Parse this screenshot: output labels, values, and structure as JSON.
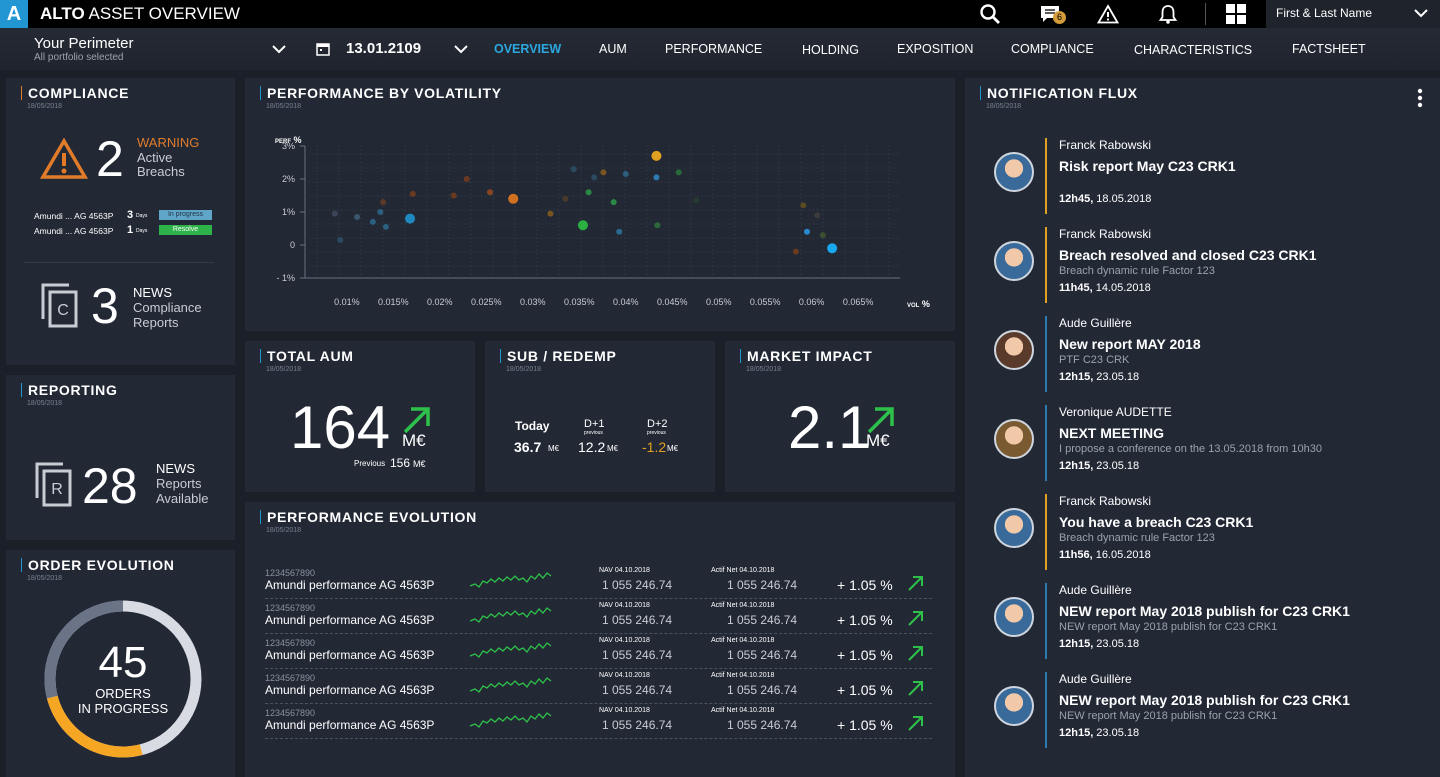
{
  "header": {
    "logo": "A",
    "title_bold": "ALTO",
    "title_rest": " ASSET OVERVIEW",
    "badge_count": "6",
    "user_name": "First & Last Name"
  },
  "perimeter": {
    "title": "Your Perimeter",
    "subtitle": "All portfolio selected",
    "date": "13.01.2109"
  },
  "nav": {
    "tabs": [
      "OVERVIEW",
      "AUM",
      "PERFORMANCE",
      "HOLDING",
      "EXPOSITION",
      "COMPLIANCE",
      "CHARACTERISTICS",
      "FACTSHEET"
    ],
    "active": "OVERVIEW"
  },
  "compliance": {
    "title": "COMPLIANCE",
    "date": "18/05/2018",
    "count": "2",
    "warning": "WARNING",
    "line1": "Active",
    "line2": "Breachs",
    "rows": [
      {
        "name": "Amundi ... AG 4563P",
        "days": "3",
        "days_label": "Days",
        "status": "In progress",
        "color": "#5fa6c8"
      },
      {
        "name": "Amundi ... AG 4563P",
        "days": "1",
        "days_label": "Days",
        "status": "Resolve",
        "color": "#2eb24a"
      }
    ],
    "news_count": "3",
    "news": "NEWS",
    "news_l1": "Compliance",
    "news_l2": "Reports",
    "icon_letter": "C"
  },
  "reporting": {
    "title": "REPORTING",
    "date": "18/05/2018",
    "count": "28",
    "news": "NEWS",
    "l1": "Reports",
    "l2": "Available",
    "icon_letter": "R"
  },
  "orders": {
    "title": "ORDER EVOLUTION",
    "date": "18/05/2018",
    "count": "45",
    "l1": "ORDERS",
    "l2": "IN PROGRESS",
    "progress": 0.25
  },
  "perf_vol": {
    "title": "PERFORMANCE BY VOLATILITY",
    "date": "18/05/2018"
  },
  "chart_data": {
    "type": "scatter",
    "title": "PERFORMANCE BY VOLATILITY",
    "xlabel": "VOL %",
    "ylabel": "PERF %",
    "x_ticks": [
      "0.01%",
      "0.015%",
      "0.02%",
      "0.025%",
      "0.03%",
      "0.035%",
      "0.04%",
      "0.045%",
      "0.05%",
      "0.055%",
      "0.06%",
      "0.065%"
    ],
    "y_ticks": [
      "3%",
      "2%",
      "1%",
      "0",
      "- 1%"
    ],
    "xlim": [
      0.0055,
      0.0695
    ],
    "ylim": [
      -1,
      3
    ],
    "points": [
      {
        "x": 0.0087,
        "y": 0.95,
        "color": "#3a4558",
        "r": 3
      },
      {
        "x": 0.0093,
        "y": 0.15,
        "color": "#2a4a60",
        "r": 3
      },
      {
        "x": 0.0111,
        "y": 0.85,
        "color": "#3d5670",
        "r": 3
      },
      {
        "x": 0.0128,
        "y": 0.7,
        "color": "#2c5f80",
        "r": 3
      },
      {
        "x": 0.0136,
        "y": 1.0,
        "color": "#2c5f80",
        "r": 3
      },
      {
        "x": 0.0139,
        "y": 1.3,
        "color": "#5a3a2a",
        "r": 3
      },
      {
        "x": 0.0142,
        "y": 0.55,
        "color": "#2c5f80",
        "r": 3
      },
      {
        "x": 0.0168,
        "y": 0.8,
        "color": "#1f8ac0",
        "r": 5
      },
      {
        "x": 0.0171,
        "y": 1.55,
        "color": "#6a3a20",
        "r": 3
      },
      {
        "x": 0.0215,
        "y": 1.5,
        "color": "#6a3a20",
        "r": 3
      },
      {
        "x": 0.0229,
        "y": 2.0,
        "color": "#6a3a20",
        "r": 3
      },
      {
        "x": 0.0254,
        "y": 1.6,
        "color": "#8a4520",
        "r": 3
      },
      {
        "x": 0.0279,
        "y": 1.4,
        "color": "#d07020",
        "r": 5
      },
      {
        "x": 0.0319,
        "y": 0.95,
        "color": "#7a5520",
        "r": 3
      },
      {
        "x": 0.0335,
        "y": 1.4,
        "color": "#4a3a2a",
        "r": 3
      },
      {
        "x": 0.0344,
        "y": 2.3,
        "color": "#2a4a60",
        "r": 3
      },
      {
        "x": 0.0354,
        "y": 0.6,
        "color": "#2ab040",
        "r": 5
      },
      {
        "x": 0.036,
        "y": 1.6,
        "color": "#2a8a45",
        "r": 3
      },
      {
        "x": 0.0366,
        "y": 2.05,
        "color": "#2a4a60",
        "r": 3
      },
      {
        "x": 0.0376,
        "y": 2.2,
        "color": "#7a5520",
        "r": 3
      },
      {
        "x": 0.0387,
        "y": 1.3,
        "color": "#2a8a45",
        "r": 3
      },
      {
        "x": 0.0393,
        "y": 0.4,
        "color": "#2a6a90",
        "r": 3
      },
      {
        "x": 0.04,
        "y": 2.15,
        "color": "#2c5f80",
        "r": 3
      },
      {
        "x": 0.0433,
        "y": 2.7,
        "color": "#e0a020",
        "r": 5
      },
      {
        "x": 0.0433,
        "y": 2.05,
        "color": "#2c7ab0",
        "r": 3
      },
      {
        "x": 0.0434,
        "y": 0.6,
        "color": "#2a6a3a",
        "r": 3
      },
      {
        "x": 0.0457,
        "y": 2.2,
        "color": "#2a6a3a",
        "r": 3
      },
      {
        "x": 0.0476,
        "y": 1.35,
        "color": "#263a30",
        "r": 3
      },
      {
        "x": 0.0583,
        "y": -0.2,
        "color": "#6a3a20",
        "r": 3
      },
      {
        "x": 0.0591,
        "y": 1.2,
        "color": "#5a4a20",
        "r": 3
      },
      {
        "x": 0.0595,
        "y": 0.4,
        "color": "#2a8ad0",
        "r": 3
      },
      {
        "x": 0.0606,
        "y": 0.9,
        "color": "#3a3a3a",
        "r": 3
      },
      {
        "x": 0.0612,
        "y": 0.3,
        "color": "#3a5030",
        "r": 3
      },
      {
        "x": 0.0622,
        "y": -0.1,
        "color": "#18a8f0",
        "r": 5
      }
    ]
  },
  "total_aum": {
    "title": "TOTAL  AUM",
    "date": "18/05/2018",
    "value": "164",
    "unit": "M€",
    "prev_label": "Previous",
    "prev_value": "156",
    "prev_unit": "M€"
  },
  "sub_redemp": {
    "title": "SUB / REDEMP",
    "date": "18/05/2018",
    "cols": [
      {
        "label": "Today",
        "sub": "",
        "value": "36.7",
        "unit": "M€",
        "color": "#ffffff"
      },
      {
        "label": "D+1",
        "sub": "previous",
        "value": "12.2",
        "unit": "M€",
        "color": "#ffffff"
      },
      {
        "label": "D+2",
        "sub": "previous",
        "value": "-1.2",
        "unit": "M€",
        "color": "#e0a020"
      }
    ]
  },
  "market_impact": {
    "title": "MARKET IMPACT",
    "date": "18/05/2018",
    "value": "2.1",
    "unit": "M€"
  },
  "perf_evolution": {
    "title": "PERFORMANCE EVOLUTION",
    "date": "18/05/2018",
    "rows": [
      {
        "id": "1234567890",
        "name": "Amundi performance AG 4563P",
        "nav_label": "NAV 04.10.2018",
        "nav": "1 055 246.74",
        "net_label": "Actif Net 04.10.2018",
        "net": "1 055 246.74",
        "change": "+ 1.05 %"
      },
      {
        "id": "1234567890",
        "name": "Amundi performance AG 4563P",
        "nav_label": "NAV 04.10.2018",
        "nav": "1 055 246.74",
        "net_label": "Actif Net 04.10.2018",
        "net": "1 055 246.74",
        "change": "+ 1.05 %"
      },
      {
        "id": "1234567890",
        "name": "Amundi performance AG 4563P",
        "nav_label": "NAV 04.10.2018",
        "nav": "1 055 246.74",
        "net_label": "Actif Net 04.10.2018",
        "net": "1 055 246.74",
        "change": "+ 1.05 %"
      },
      {
        "id": "1234567890",
        "name": "Amundi performance AG 4563P",
        "nav_label": "NAV 04.10.2018",
        "nav": "1 055 246.74",
        "net_label": "Actif Net 04.10.2018",
        "net": "1 055 246.74",
        "change": "+ 1.05 %"
      },
      {
        "id": "1234567890",
        "name": "Amundi performance AG 4563P",
        "nav_label": "NAV 04.10.2018",
        "nav": "1 055 246.74",
        "net_label": "Actif Net 04.10.2018",
        "net": "1 055 246.74",
        "change": "+ 1.05 %"
      }
    ]
  },
  "notifications": {
    "title": "NOTIFICATION FLUX",
    "date": "18/05/2018",
    "items": [
      {
        "author": "Franck Rabowski",
        "title": "Risk report May C23 CRK1",
        "sub": "",
        "time_bold": "12h45,",
        "time_rest": " 18.05.2018",
        "accent": "#e0a020"
      },
      {
        "author": "Franck Rabowski",
        "title": "Breach resolved and closed C23 CRK1",
        "sub": "Breach dynamic rule Factor 123",
        "time_bold": "11h45,",
        "time_rest": " 14.05.2018",
        "accent": "#e0a020"
      },
      {
        "author": "Aude Guillère",
        "title": "New report MAY 2018",
        "sub": "PTF C23 CRK",
        "time_bold": "12h15,",
        "time_rest": " 23.05.18",
        "accent": "#2c7ab0"
      },
      {
        "author": "Veronique AUDETTE",
        "title": "NEXT MEETING",
        "sub": "I propose a conference on the 13.05.2018 from 10h30",
        "time_bold": "12h15,",
        "time_rest": " 23.05.18",
        "accent": "#2c7ab0"
      },
      {
        "author": "Franck Rabowski",
        "title": "You have a breach C23 CRK1",
        "sub": "Breach dynamic rule Factor 123",
        "time_bold": "11h56,",
        "time_rest": " 16.05.2018",
        "accent": "#e0a020"
      },
      {
        "author": "Aude Guillère",
        "title": "NEW report May 2018 publish for C23 CRK1",
        "sub": "NEW report May 2018 publish for C23 CRK1",
        "time_bold": "12h15,",
        "time_rest": " 23.05.18",
        "accent": "#2c7ab0"
      },
      {
        "author": "Aude Guillère",
        "title": "NEW report May 2018 publish for C23 CRK1",
        "sub": "NEW report May 2018 publish for C23 CRK1",
        "time_bold": "12h15,",
        "time_rest": " 23.05.18",
        "accent": "#2c7ab0"
      }
    ]
  },
  "colors": {
    "accent_blue": "#2ca7e0",
    "warning_orange": "#e07b2a",
    "positive_green": "#2ec14a"
  }
}
